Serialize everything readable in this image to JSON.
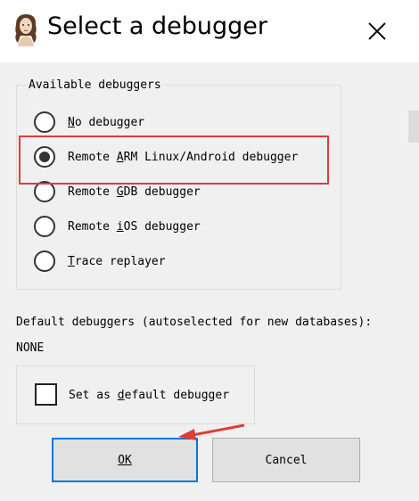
{
  "window": {
    "title": "Select a debugger",
    "icon": "portrait-icon",
    "close_icon": "close-icon"
  },
  "debuggers_group": {
    "legend": "Available debuggers",
    "options": [
      {
        "pre": "",
        "key": "N",
        "post": "o debugger",
        "selected": false
      },
      {
        "pre": "Remote ",
        "key": "A",
        "post": "RM Linux/Android debugger",
        "selected": true
      },
      {
        "pre": "Remote ",
        "key": "G",
        "post": "DB debugger",
        "selected": false
      },
      {
        "pre": "Remote ",
        "key": "i",
        "post": "OS debugger",
        "selected": false
      },
      {
        "pre": "",
        "key": "T",
        "post": "race replayer",
        "selected": false
      }
    ]
  },
  "defaults": {
    "heading": "Default debuggers (autoselected for new databases):",
    "value": "NONE"
  },
  "set_default": {
    "pre": "Set as ",
    "key": "d",
    "post": "efault debugger",
    "checked": false
  },
  "buttons": {
    "ok": "OK",
    "cancel": "Cancel"
  },
  "annotation_colors": {
    "highlight": "#e03c3c",
    "focus": "#0078d7"
  }
}
